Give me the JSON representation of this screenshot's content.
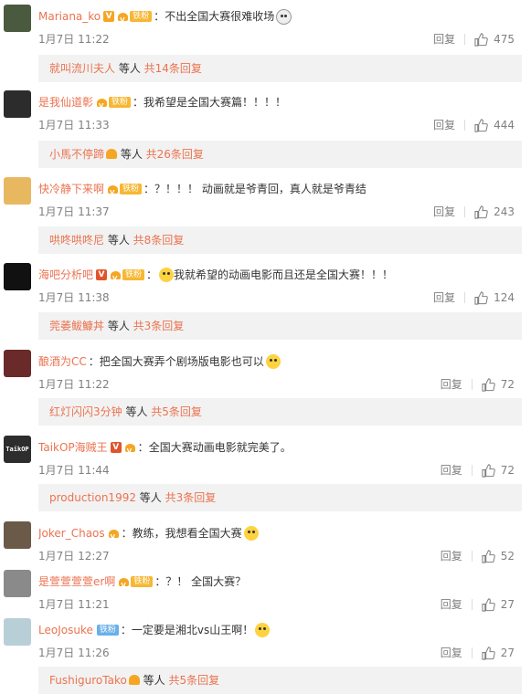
{
  "actions": {
    "reply_label": "回复"
  },
  "comments": [
    {
      "user": "Mariana_ko",
      "fan_label": "铁粉",
      "colon": "：",
      "text": "不出全国大赛很难收场",
      "time": "1月7日 11:22",
      "likes": "475",
      "sub_user": "就叫流川夫人",
      "sub_mid": " 等人 ",
      "sub_count": "共14条回复",
      "avatar_color": "#4a5a3e"
    },
    {
      "user": "是我仙道彰",
      "fan_label": "铁粉",
      "colon": "：",
      "text": "我希望是全国大赛篇！！！！",
      "time": "1月7日 11:33",
      "likes": "444",
      "sub_user": "小馬不停蹄",
      "sub_mid": " 等人 ",
      "sub_count": "共26条回复",
      "avatar_color": "#2c2c2c"
    },
    {
      "user": "快冷静下来啊",
      "fan_label": "铁粉",
      "colon": "：",
      "text": "？！！！ 动画就是爷青回，真人就是爷青结",
      "time": "1月7日 11:37",
      "likes": "243",
      "sub_user": "哄咚哄咚尼",
      "sub_mid": " 等人 ",
      "sub_count": "共8条回复",
      "avatar_color": "#e8b860"
    },
    {
      "user": "海吧分析吧",
      "fan_label": "铁粉",
      "colon": "：",
      "text": "我就希望的动画电影而且还是全国大赛！！！",
      "time": "1月7日 11:38",
      "likes": "124",
      "sub_user": "莞萎鲅鱇丼",
      "sub_mid": " 等人 ",
      "sub_count": "共3条回复",
      "avatar_color": "#111111"
    },
    {
      "user": "酿酒为CC",
      "fan_label": "",
      "colon": "：",
      "text": "把全国大赛弄个剧场版电影也可以",
      "time": "1月7日 11:22",
      "likes": "72",
      "sub_user": "红灯闪闪3分钟",
      "sub_mid": " 等人 ",
      "sub_count": "共5条回复",
      "avatar_color": "#6a2a2a"
    },
    {
      "user": "TaikOP海贼王",
      "fan_label": "",
      "colon": "：",
      "text": "全国大赛动画电影就完美了。",
      "time": "1月7日 11:44",
      "likes": "72",
      "sub_user": "production1992",
      "sub_mid": " 等人 ",
      "sub_count": "共3条回复",
      "avatar_color": "#2d2d2d",
      "avatar_text": "TaikOP"
    },
    {
      "user": "Joker_Chaos",
      "fan_label": "",
      "colon": "：",
      "text": "教练，我想看全国大赛",
      "time": "1月7日 12:27",
      "likes": "52",
      "avatar_color": "#6b5a48"
    },
    {
      "user": "是萱萱萱萱er啊",
      "fan_label": "铁粉",
      "colon": "：",
      "text": "？！ 全国大赛？",
      "time": "1月7日 11:21",
      "likes": "27",
      "avatar_color": "#8a8a8a"
    },
    {
      "user": "LeoJosuke",
      "fan_label": "铁粉",
      "colon": "：",
      "text": "一定要是湘北vs山王啊！",
      "time": "1月7日 11:26",
      "likes": "27",
      "sub_user": "FushiguroTako",
      "sub_mid": " 等人 ",
      "sub_count": "共5条回复",
      "avatar_color": "#b8cfd8"
    }
  ]
}
